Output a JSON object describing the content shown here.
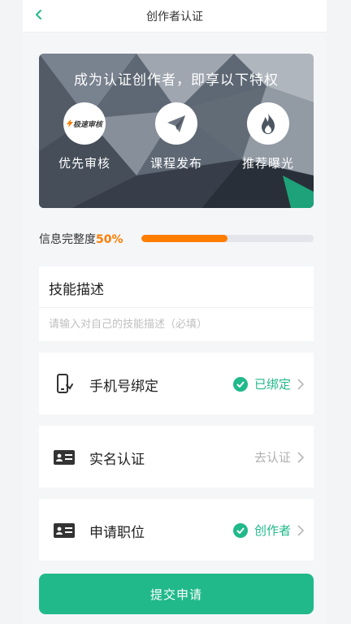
{
  "header": {
    "title": "创作者认证"
  },
  "banner": {
    "title": "成为认证创作者，即享以下特权",
    "perks": [
      {
        "label": "优先审核",
        "badge": "极速审核",
        "icon": "lightning-badge-icon"
      },
      {
        "label": "课程发布",
        "icon": "paper-plane-icon"
      },
      {
        "label": "推荐曝光",
        "icon": "flame-icon"
      }
    ]
  },
  "progress": {
    "label": "信息完整度",
    "percent_text": "50%",
    "value": 0.5,
    "color": "#ff7d00"
  },
  "skill": {
    "title": "技能描述",
    "placeholder": "请输入对自己的技能描述（必填）",
    "value": ""
  },
  "rows": [
    {
      "label": "手机号绑定",
      "status": "已绑定",
      "verified": true,
      "icon": "phone-icon"
    },
    {
      "label": "实名认证",
      "status": "去认证",
      "verified": false,
      "icon": "id-card-icon"
    },
    {
      "label": "申请职位",
      "status": "创作者",
      "verified": true,
      "icon": "id-card-icon"
    }
  ],
  "submit": {
    "label": "提交申请"
  },
  "colors": {
    "accent": "#21b98a",
    "progress": "#ff7d00"
  }
}
